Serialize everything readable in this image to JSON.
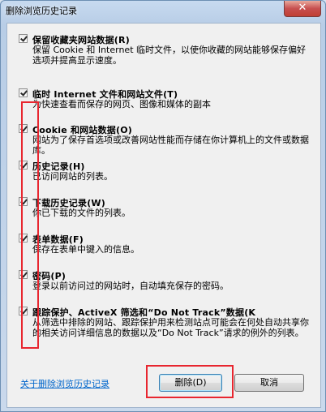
{
  "window": {
    "title": "删除浏览历史记录",
    "close_glyph": "✕"
  },
  "items": [
    {
      "title": "保留收藏夹网站数据(R)",
      "desc": "保留 Cookie 和 Internet 临时文件，以使你收藏的网站能够保存偏好选项并提高显示速度。",
      "checked": true
    },
    {
      "title": "临时 Internet 文件和网站文件(T)",
      "desc": "为快速查看而保存的网页、图像和媒体的副本",
      "checked": true
    },
    {
      "title": "Cookie 和网站数据(O)",
      "desc": "网站为了保存首选项或改善网站性能而存储在你计算机上的文件或数据库。",
      "checked": true
    },
    {
      "title": "历史记录(H)",
      "desc": "已访问网站的列表。",
      "checked": true
    },
    {
      "title": "下载历史记录(W)",
      "desc": "你已下载的文件的列表。",
      "checked": true
    },
    {
      "title": "表单数据(F)",
      "desc": "保存在表单中键入的信息。",
      "checked": true
    },
    {
      "title": "密码(P)",
      "desc": "登录以前访问过的网站时，自动填充保存的密码。",
      "checked": true
    },
    {
      "title": "跟踪保护、ActiveX 筛选和“Do Not Track”数据(K",
      "desc": "从筛选中排除的网站、跟踪保护用来检测站点可能会在何处自动共享你的相关访问详细信息的数据以及“Do Not Track”请求的例外的列表。",
      "checked": true
    }
  ],
  "footer": {
    "link": "关于删除浏览历史记录",
    "delete_label": "删除(D)",
    "cancel_label": "取消"
  },
  "colors": {
    "highlight": "#e8262f",
    "link": "#0066cc"
  }
}
